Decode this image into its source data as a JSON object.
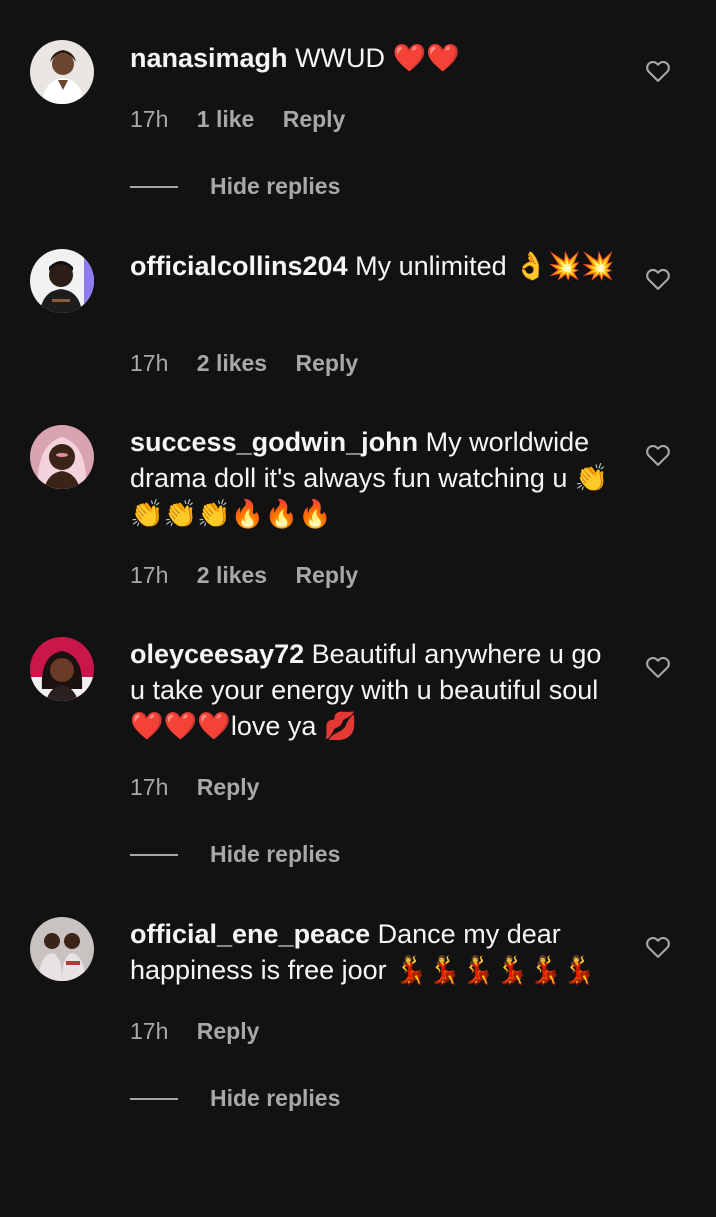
{
  "comments": [
    {
      "username": "nanasimagh",
      "text": "WWUD ❤️❤️",
      "time": "17h",
      "likes": "1 like",
      "reply": "Reply",
      "hide_replies": "Hide replies"
    },
    {
      "username": "officialcollins204",
      "text": "My unlimited 👌💥💥",
      "time": "17h",
      "likes": "2 likes",
      "reply": "Reply"
    },
    {
      "username": "success_godwin_john",
      "text": "My worldwide drama doll it's always fun watching u 👏👏👏👏🔥🔥🔥",
      "time": "17h",
      "likes": "2 likes",
      "reply": "Reply"
    },
    {
      "username": "oleyceesay72",
      "text": "Beautiful anywhere u go u take your energy with u beautiful soul ❤️❤️❤️love ya 💋",
      "time": "17h",
      "reply": "Reply",
      "hide_replies": "Hide replies"
    },
    {
      "username": "official_ene_peace",
      "text": "Dance my dear happiness is free joor 💃💃💃💃💃💃",
      "time": "17h",
      "reply": "Reply",
      "hide_replies": "Hide replies"
    }
  ],
  "colors": {
    "background": "#121212",
    "text": "#f5f5f5",
    "secondary_text": "#a8a8a8"
  },
  "icons": {
    "like": "heart-outline-icon"
  }
}
